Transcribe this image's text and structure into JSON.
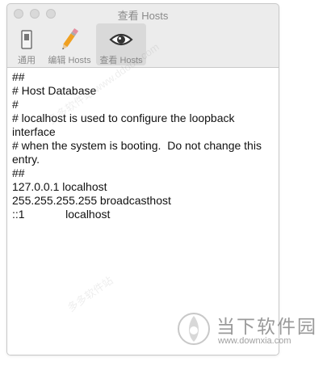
{
  "window": {
    "title": "查看 Hosts"
  },
  "toolbar": {
    "items": [
      {
        "label": "通用",
        "icon": "switch-icon"
      },
      {
        "label": "编辑 Hosts",
        "icon": "pencil-icon"
      },
      {
        "label": "查看 Hosts",
        "icon": "eye-icon",
        "selected": true
      }
    ]
  },
  "content": {
    "hosts_text": "##\n# Host Database\n#\n# localhost is used to configure the loopback interface\n# when the system is booting.  Do not change this entry.\n##\n127.0.0.1\tlocalhost\n255.255.255.255\tbroadcasthost\n::1             localhost"
  },
  "watermarks": {
    "site_top": "多多软件站 www.ddooo.com",
    "site_bottom": "多多软件站"
  },
  "logo": {
    "name": "当下软件园",
    "url": "www.downxia.com"
  },
  "colors": {
    "window_bg": "#ececec",
    "selected_tab": "#d9d9d9",
    "text": "#111111",
    "muted": "#8a8a8a"
  }
}
